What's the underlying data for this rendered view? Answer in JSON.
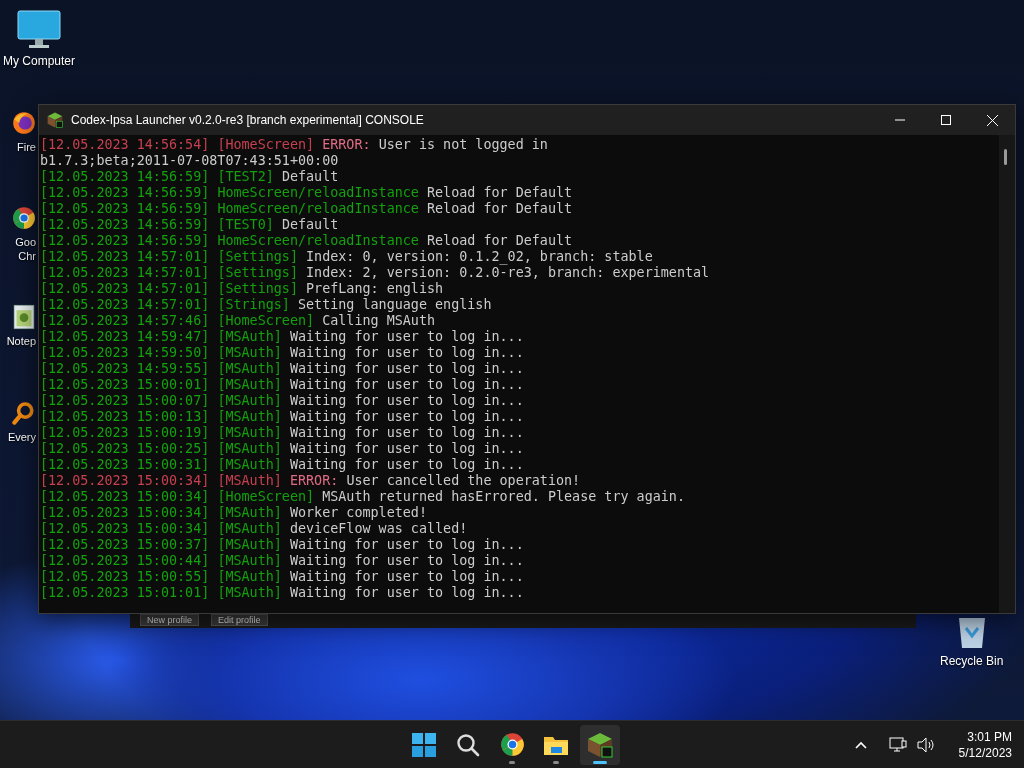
{
  "desktop_icons": [
    {
      "kind": "computer",
      "lines": [
        "My Computer"
      ]
    },
    {
      "kind": "firefox",
      "lines": [
        "Fire"
      ]
    },
    {
      "kind": "chrome",
      "lines": [
        "Goo",
        "Chr"
      ]
    },
    {
      "kind": "notepad",
      "lines": [
        "Notep"
      ]
    },
    {
      "kind": "everything",
      "lines": [
        "Every"
      ]
    }
  ],
  "recycle_bin": {
    "label": "Recycle Bin"
  },
  "background_window": {
    "buttons": [
      "New profile",
      "Edit profile"
    ]
  },
  "console_window": {
    "title": "Codex-Ipsa Launcher v0.2.0-re3 [branch experimental] CONSOLE",
    "log": [
      {
        "kind": "error",
        "time": "[12.05.2023 14:56:54]",
        "tag": "[HomeScreen]",
        "label": "ERROR:",
        "message": "User is not logged in"
      },
      {
        "kind": "plain",
        "message": "b1.7.3;beta;2011-07-08T07:43:51+00:00"
      },
      {
        "kind": "info",
        "time": "[12.05.2023 14:56:59]",
        "tag": "[TEST2]",
        "message": "Default"
      },
      {
        "kind": "info",
        "time": "[12.05.2023 14:56:59]",
        "tag": "HomeScreen/reloadInstance",
        "message": "Reload for Default"
      },
      {
        "kind": "info",
        "time": "[12.05.2023 14:56:59]",
        "tag": "HomeScreen/reloadInstance",
        "message": "Reload for Default"
      },
      {
        "kind": "info",
        "time": "[12.05.2023 14:56:59]",
        "tag": "[TEST0]",
        "message": "Default"
      },
      {
        "kind": "info",
        "time": "[12.05.2023 14:56:59]",
        "tag": "HomeScreen/reloadInstance",
        "message": "Reload for Default"
      },
      {
        "kind": "info",
        "time": "[12.05.2023 14:57:01]",
        "tag": "[Settings]",
        "message": "Index: 0, version: 0.1.2_02, branch: stable"
      },
      {
        "kind": "info",
        "time": "[12.05.2023 14:57:01]",
        "tag": "[Settings]",
        "message": "Index: 2, version: 0.2.0-re3, branch: experimental"
      },
      {
        "kind": "info",
        "time": "[12.05.2023 14:57:01]",
        "tag": "[Settings]",
        "message": "PrefLang: english"
      },
      {
        "kind": "info",
        "time": "[12.05.2023 14:57:01]",
        "tag": "[Strings]",
        "message": "Setting language english"
      },
      {
        "kind": "info",
        "time": "[12.05.2023 14:57:46]",
        "tag": "[HomeScreen]",
        "message": "Calling MSAuth"
      },
      {
        "kind": "info",
        "time": "[12.05.2023 14:59:47]",
        "tag": "[MSAuth]",
        "message": "Waiting for user to log in..."
      },
      {
        "kind": "info",
        "time": "[12.05.2023 14:59:50]",
        "tag": "[MSAuth]",
        "message": "Waiting for user to log in..."
      },
      {
        "kind": "info",
        "time": "[12.05.2023 14:59:55]",
        "tag": "[MSAuth]",
        "message": "Waiting for user to log in..."
      },
      {
        "kind": "info",
        "time": "[12.05.2023 15:00:01]",
        "tag": "[MSAuth]",
        "message": "Waiting for user to log in..."
      },
      {
        "kind": "info",
        "time": "[12.05.2023 15:00:07]",
        "tag": "[MSAuth]",
        "message": "Waiting for user to log in..."
      },
      {
        "kind": "info",
        "time": "[12.05.2023 15:00:13]",
        "tag": "[MSAuth]",
        "message": "Waiting for user to log in..."
      },
      {
        "kind": "info",
        "time": "[12.05.2023 15:00:19]",
        "tag": "[MSAuth]",
        "message": "Waiting for user to log in..."
      },
      {
        "kind": "info",
        "time": "[12.05.2023 15:00:25]",
        "tag": "[MSAuth]",
        "message": "Waiting for user to log in..."
      },
      {
        "kind": "info",
        "time": "[12.05.2023 15:00:31]",
        "tag": "[MSAuth]",
        "message": "Waiting for user to log in..."
      },
      {
        "kind": "error",
        "time": "[12.05.2023 15:00:34]",
        "tag": "[MSAuth]",
        "label": "ERROR:",
        "message": "User cancelled the operation!"
      },
      {
        "kind": "info",
        "time": "[12.05.2023 15:00:34]",
        "tag": "[HomeScreen]",
        "message": "MSAuth returned hasErrored. Please try again."
      },
      {
        "kind": "info",
        "time": "[12.05.2023 15:00:34]",
        "tag": "[MSAuth]",
        "message": "Worker completed!"
      },
      {
        "kind": "info",
        "time": "[12.05.2023 15:00:34]",
        "tag": "[MSAuth]",
        "message": "deviceFlow was called!"
      },
      {
        "kind": "info",
        "time": "[12.05.2023 15:00:37]",
        "tag": "[MSAuth]",
        "message": "Waiting for user to log in..."
      },
      {
        "kind": "info",
        "time": "[12.05.2023 15:00:44]",
        "tag": "[MSAuth]",
        "message": "Waiting for user to log in..."
      },
      {
        "kind": "info",
        "time": "[12.05.2023 15:00:55]",
        "tag": "[MSAuth]",
        "message": "Waiting for user to log in..."
      },
      {
        "kind": "info",
        "time": "[12.05.2023 15:01:01]",
        "tag": "[MSAuth]",
        "message": "Waiting for user to log in..."
      }
    ]
  },
  "taskbar": {
    "apps": [
      {
        "kind": "start",
        "running": false,
        "selected": false
      },
      {
        "kind": "search",
        "running": false,
        "selected": false
      },
      {
        "kind": "chrome",
        "running": true,
        "selected": false
      },
      {
        "kind": "explorer",
        "running": true,
        "selected": false
      },
      {
        "kind": "launcher",
        "running": true,
        "selected": true
      }
    ],
    "clock": {
      "time": "3:01 PM",
      "date": "5/12/2023"
    }
  }
}
